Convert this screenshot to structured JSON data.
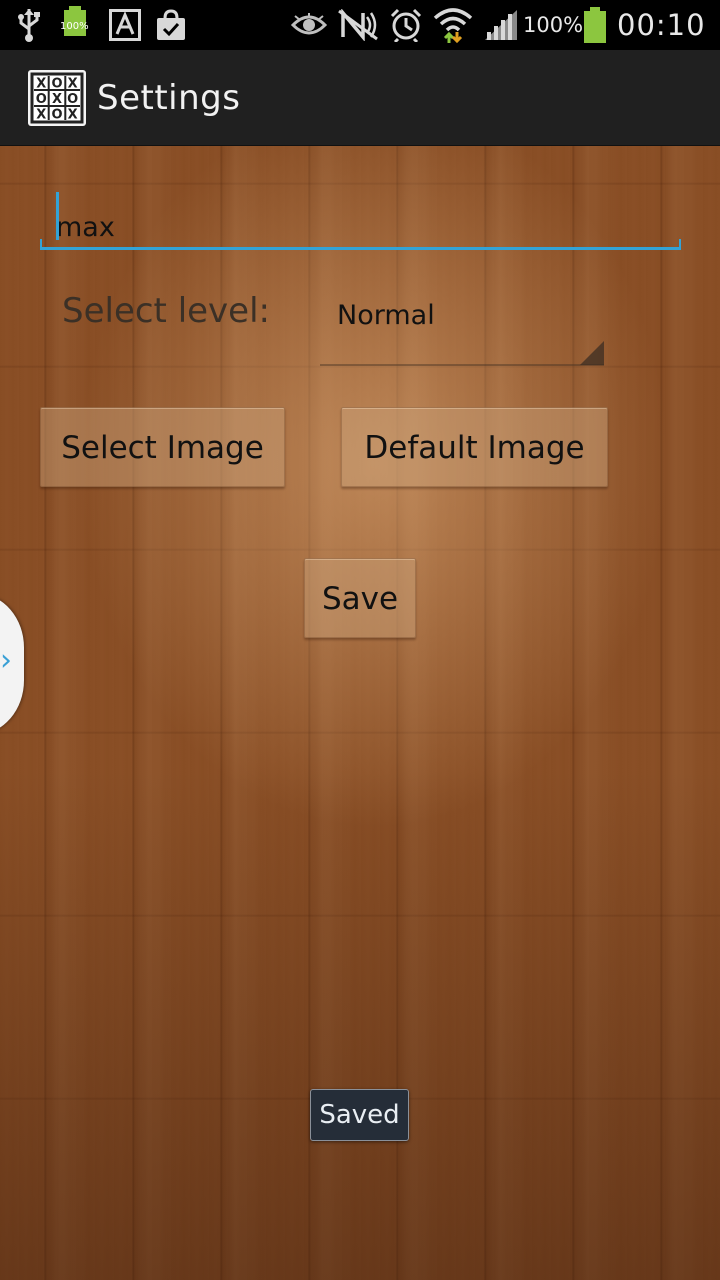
{
  "status_bar": {
    "icons": [
      "usb-icon",
      "battery-small-icon",
      "font-a-icon",
      "shopping-bag-icon",
      "eye-icon",
      "nfc-muted-icon",
      "alarm-icon",
      "wifi-icon",
      "signal-icon",
      "battery-icon"
    ],
    "small_battery_label": "100%",
    "battery_percent": "100%",
    "time": "00:10"
  },
  "action_bar": {
    "title": "Settings",
    "app_icon": "tic-tac-toe-icon",
    "app_icon_grid": [
      "X",
      "O",
      "X",
      "O",
      "X",
      "O",
      "X",
      "O",
      "X"
    ]
  },
  "form": {
    "name_value": "max",
    "level_label": "Select level:",
    "level_selected": "Normal",
    "select_image_label": "Select Image",
    "default_image_label": "Default Image",
    "save_label": "Save"
  },
  "toast": {
    "message": "Saved"
  },
  "colors": {
    "accent": "#33a3d6",
    "battery_green": "#8cc63f",
    "toast_bg": "#252d38"
  }
}
